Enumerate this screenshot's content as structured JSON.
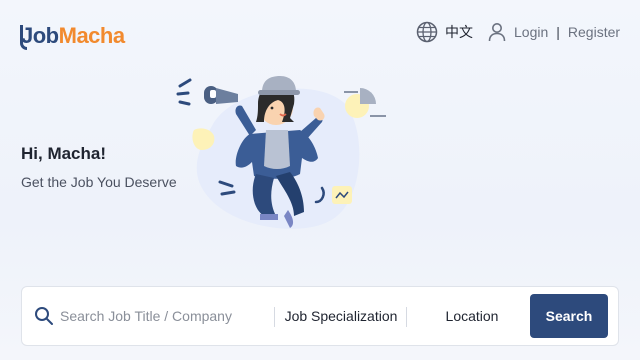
{
  "brand": {
    "logo_part1": "Job",
    "logo_part2": "Macha",
    "primary_color": "#2d4a7c",
    "accent_color": "#f28a2e"
  },
  "header": {
    "language_icon": "globe-icon",
    "language_label": "中文",
    "user_icon": "user-icon",
    "login_label": "Login",
    "separator": "|",
    "register_label": "Register"
  },
  "hero": {
    "greeting": "Hi, Macha!",
    "subtitle": "Get the Job You Deserve",
    "illustration": "person-with-megaphone-illustration"
  },
  "search": {
    "icon": "search-icon",
    "placeholder": "Search Job Title / Company",
    "value": "",
    "specialization_label": "Job Specialization",
    "location_label": "Location",
    "button_label": "Search"
  }
}
